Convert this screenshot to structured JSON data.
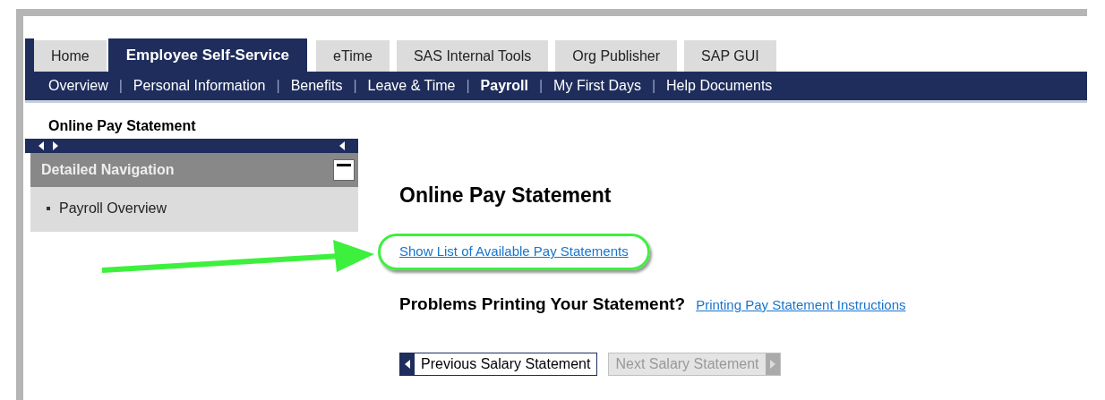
{
  "tabs": [
    {
      "label": "Home",
      "selected": false
    },
    {
      "label": "Employee Self-Service",
      "selected": true
    },
    {
      "label": "eTime",
      "selected": false
    },
    {
      "label": "SAS Internal Tools",
      "selected": false
    },
    {
      "label": "Org Publisher",
      "selected": false
    },
    {
      "label": "SAP GUI",
      "selected": false
    }
  ],
  "subnav": [
    {
      "label": "Overview",
      "selected": false
    },
    {
      "label": "Personal Information",
      "selected": false
    },
    {
      "label": "Benefits",
      "selected": false
    },
    {
      "label": "Leave & Time",
      "selected": false
    },
    {
      "label": "Payroll",
      "selected": true
    },
    {
      "label": "My First Days",
      "selected": false
    },
    {
      "label": "Help Documents",
      "selected": false
    }
  ],
  "subnav_separator": "|",
  "breadcrumb": "Online Pay Statement",
  "sidebar": {
    "title": "Detailed Navigation",
    "expanded": true,
    "items": [
      {
        "label": "Payroll Overview"
      }
    ]
  },
  "main": {
    "title": "Online Pay Statement",
    "link": "Show List of Available Pay Statements",
    "highlighted": true,
    "problems_label": "Problems Printing Your Statement?",
    "problems_link": "Printing Pay Statement Instructions",
    "buttons": [
      {
        "kind": "previous",
        "label": "Previous Salary Statement",
        "disabled": false
      },
      {
        "kind": "next",
        "label": "Next Salary Statement",
        "disabled": true
      }
    ]
  }
}
